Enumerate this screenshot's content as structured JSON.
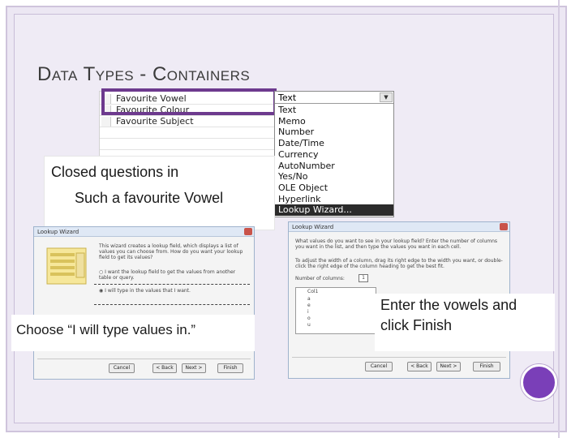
{
  "slide": {
    "title": "Data Types - Containers",
    "accent_color": "#6d3a8e",
    "dot_color": "#7a3fb8"
  },
  "field_list": {
    "rows": [
      "Favourite Vowel",
      "Favourite Colour",
      "Favourite Subject"
    ]
  },
  "data_type_dropdown": {
    "selected": "Text",
    "options": [
      "Text",
      "Memo",
      "Number",
      "Date/Time",
      "Currency",
      "AutoNumber",
      "Yes/No",
      "OLE Object",
      "Hyperlink",
      "Lookup Wizard..."
    ],
    "highlighted": "Lookup Wizard..."
  },
  "callouts": {
    "closed_questions_line1": "Closed questions in",
    "closed_questions_line2": "Such a favourite Vowel",
    "choose_option": "Choose “I will type values in.”",
    "enter_vowels_line1": "Enter the vowels and",
    "enter_vowels_line2": "click Finish"
  },
  "wizard1": {
    "title": "Lookup Wizard",
    "description": "This wizard creates a lookup field, which displays a list of values you can choose from. How do you want your lookup field to get its values?",
    "option1": "I want the lookup field to get the values from another table or query.",
    "option2": "I will type in the values that I want.",
    "buttons": [
      "Cancel",
      "< Back",
      "Next >",
      "Finish"
    ]
  },
  "wizard2": {
    "title": "Lookup Wizard",
    "description": "What values do you want to see in your lookup field? Enter the number of columns you want in the list, and then type the values you want in each cell.",
    "instruction": "To adjust the width of a column, drag its right edge to the width you want, or double-click the right edge of the column heading to get the best fit.",
    "columns_label": "Number of columns:",
    "columns_value": "1",
    "column_header": "Col1",
    "values": [
      "a",
      "e",
      "i",
      "o",
      "u"
    ],
    "buttons": [
      "Cancel",
      "< Back",
      "Next >",
      "Finish"
    ]
  }
}
